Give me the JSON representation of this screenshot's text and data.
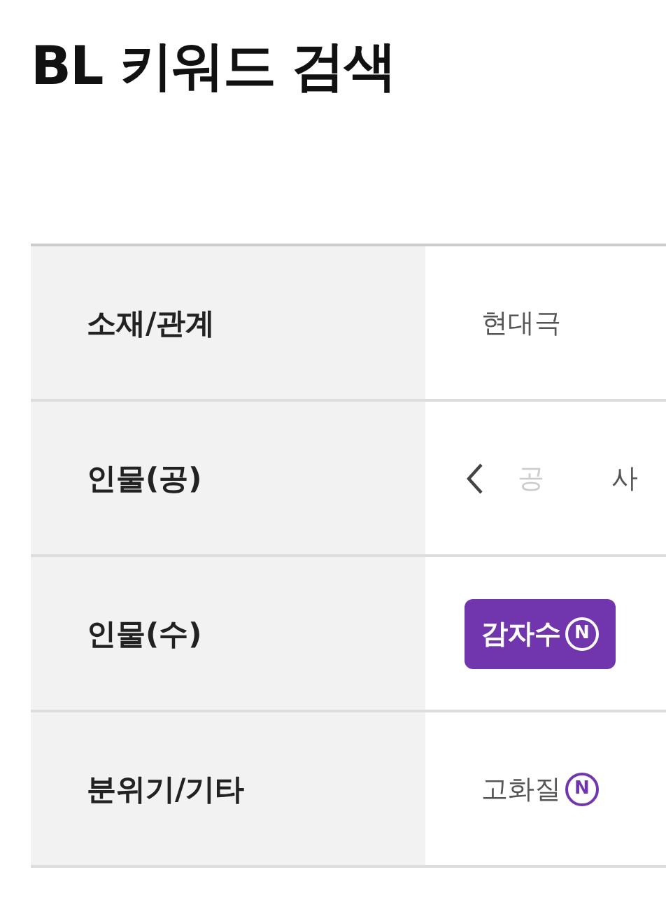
{
  "title": "BL 키워드 검색",
  "rows": [
    {
      "label": "소재/관계",
      "scrolled": false,
      "tags": [
        {
          "label": "현대극",
          "selected": false
        }
      ]
    },
    {
      "label": "인물(공)",
      "scrolled": true,
      "tags": [
        {
          "label": "공",
          "selected": false
        },
        {
          "label": "사",
          "selected": false
        }
      ]
    },
    {
      "label": "인물(수)",
      "scrolled": false,
      "tags": [
        {
          "label": "감자수",
          "selected": true,
          "badge": "N"
        }
      ]
    },
    {
      "label": "분위기/기타",
      "scrolled": false,
      "tags": [
        {
          "label": "고화질",
          "selected": false,
          "badge": "N"
        }
      ]
    }
  ]
}
